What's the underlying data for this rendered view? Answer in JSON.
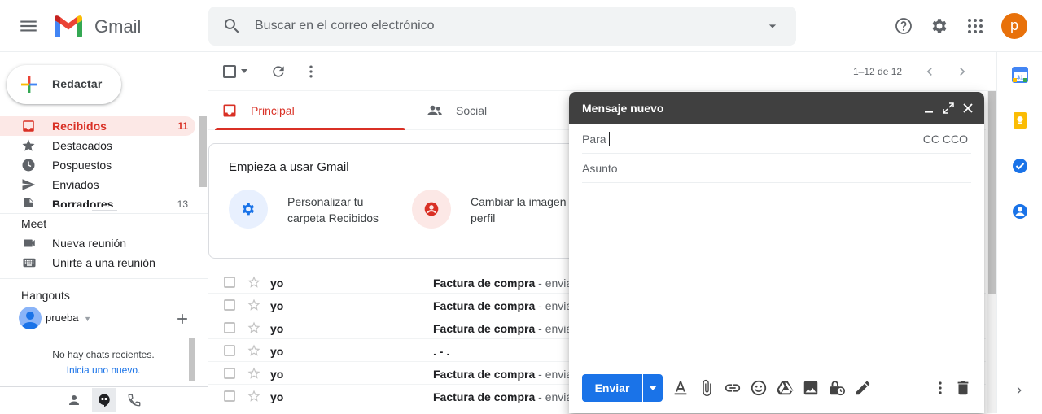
{
  "header": {
    "brand": "Gmail",
    "search_placeholder": "Buscar en el correo electrónico",
    "avatar_letter": "p",
    "avatar_color": "#e8710a"
  },
  "compose_button": {
    "label": "Redactar"
  },
  "nav": {
    "items": [
      {
        "label": "Recibidos",
        "count": "11",
        "icon": "inbox-icon",
        "active": true
      },
      {
        "label": "Destacados",
        "count": "",
        "icon": "star-icon"
      },
      {
        "label": "Pospuestos",
        "count": "",
        "icon": "clock-icon"
      },
      {
        "label": "Enviados",
        "count": "",
        "icon": "send-icon"
      },
      {
        "label": "Borradores",
        "count": "13",
        "icon": "draft-icon"
      }
    ]
  },
  "meet": {
    "title": "Meet",
    "new_meeting": "Nueva reunión",
    "join_meeting": "Unirte a una reunión"
  },
  "hangouts": {
    "title": "Hangouts",
    "user": "prueba",
    "empty": "No hay chats recientes.",
    "start_new": "Inicia uno nuevo."
  },
  "toolbar": {
    "paging": "1–12 de 12"
  },
  "tabs": [
    {
      "label": "Principal",
      "active": true
    },
    {
      "label": "Social",
      "active": false
    }
  ],
  "welcome": {
    "title": "Empieza a usar Gmail",
    "cards": [
      {
        "text": "Personalizar tu carpeta Recibidos",
        "icon": "gear-icon",
        "color": "#e8f0fe"
      },
      {
        "text": "Cambiar la imagen de perfil",
        "icon": "account-icon",
        "color": "#fce8e6"
      }
    ]
  },
  "emails": [
    {
      "from": "yo",
      "subject": "Factura de compra",
      "snippet": " - envia"
    },
    {
      "from": "yo",
      "subject": "Factura de compra",
      "snippet": " - envia"
    },
    {
      "from": "yo",
      "subject": "Factura de compra",
      "snippet": " - envia"
    },
    {
      "from": "yo",
      "subject": ". - .",
      "snippet": ""
    },
    {
      "from": "yo",
      "subject": "Factura de compra",
      "snippet": " - envia"
    },
    {
      "from": "yo",
      "subject": "Factura de compra",
      "snippet": " - envia"
    }
  ],
  "compose": {
    "title": "Mensaje nuevo",
    "to_label": "Para",
    "cc_bcc": "CC CCO",
    "subject_placeholder": "Asunto",
    "send_label": "Enviar"
  },
  "colors": {
    "accent_red": "#d93025",
    "send_blue": "#1a73e8",
    "compose_header": "#404040"
  }
}
